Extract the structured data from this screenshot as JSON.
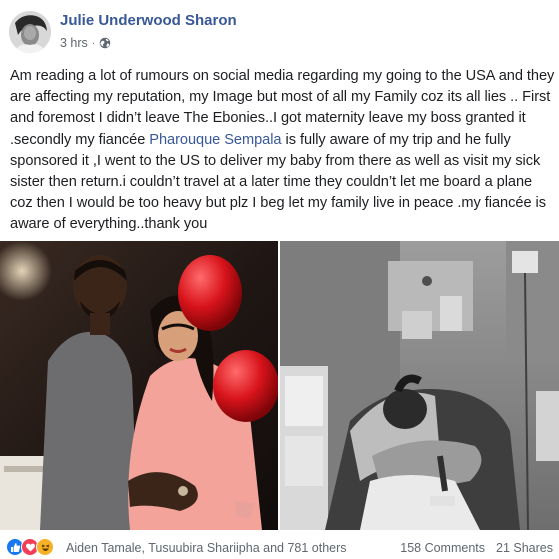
{
  "post": {
    "author": "Julie Underwood Sharon",
    "time": "3 hrs",
    "separator": "·",
    "privacy_icon": "globe-icon",
    "text_before_mention": "Am reading a lot of rumours on social media regarding my going to the USA and they are affecting my reputation, my Image but most of all my Family coz its all lies .. First and foremost I didn’t leave The Ebonies..I got maternity leave my boss granted it .secondly my fiancée ",
    "mention": "Pharouque Sempala",
    "text_after_mention": " is fully aware of my trip and he fully sponsored it ,I went to the US to deliver my baby from there as well as visit my sick sister then return.i couldn’t travel at a later time they couldn’t let me board a plane coz then I would be too heavy but plz I beg let my family live in peace .my fiancée is aware of everything..thank you"
  },
  "photos": [
    {
      "icon": "photo-couple-balloons"
    },
    {
      "icon": "photo-hospital-bed"
    }
  ],
  "footer": {
    "reaction_icons": [
      "like-icon",
      "love-icon",
      "haha-icon"
    ],
    "reacted_by": "Aiden Tamale, Tusuubira Shariipha and 781 others",
    "comments": "158 Comments",
    "shares": "21 Shares"
  },
  "colors": {
    "name_link": "#385898",
    "meta_text": "#606770",
    "like": "#1877f2",
    "love": "#f33e58",
    "haha": "#f7b125"
  }
}
